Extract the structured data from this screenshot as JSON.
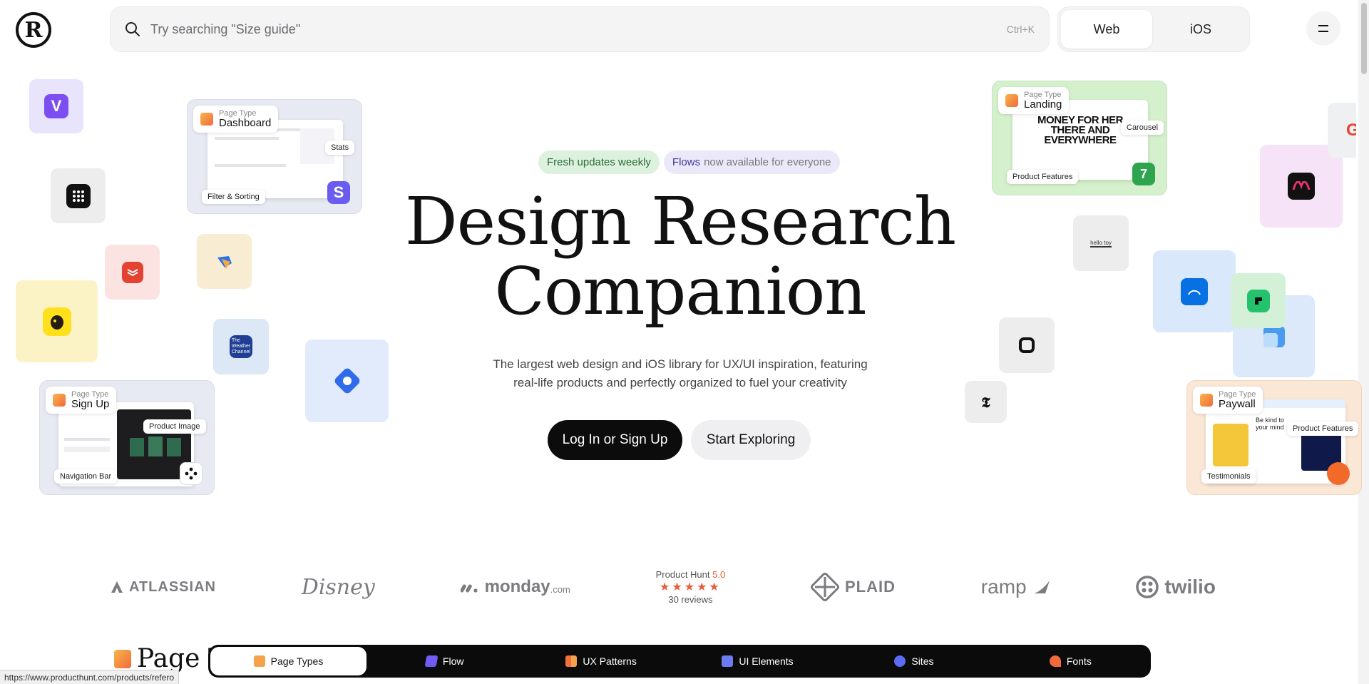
{
  "header": {
    "logo_text": "R",
    "search_placeholder": "Try searching \"Size guide\"",
    "search_shortcut": "Ctrl+K",
    "platform_options": [
      "Web",
      "iOS"
    ],
    "platform_selected": "Web"
  },
  "hero": {
    "badge_fresh": "Fresh updates weekly",
    "badge_flows_strong": "Flows",
    "badge_flows_rest": "now available for everyone",
    "title_line1": "Design Research",
    "title_line2": "Companion",
    "subtitle_line1": "The largest web design and iOS library for UX/UI inspiration, featuring",
    "subtitle_line2": "real-life products and perfectly organized to fuel your creativity",
    "cta_primary": "Log In or Sign Up",
    "cta_secondary": "Start Exploring"
  },
  "cards": {
    "dashboard": {
      "label": "Page Type",
      "value": "Dashboard",
      "chips": [
        "Stats",
        "Filter & Sorting"
      ]
    },
    "signup": {
      "label": "Page Type",
      "value": "Sign Up",
      "chips": [
        "Product Image",
        "Navigation Bar"
      ]
    },
    "landing": {
      "label": "Page Type",
      "value": "Landing",
      "chips": [
        "Carousel",
        "Product Features"
      ],
      "headline": "MONEY FOR HER THERE AND EVERYWHERE"
    },
    "paywall": {
      "label": "Page Type",
      "value": "Paywall",
      "chips": [
        "Product Features",
        "Testimonials"
      ],
      "snippet": "Be kind to your mind"
    }
  },
  "app_tiles": {
    "weather_channel": "The Weather Channel",
    "hello_text": "hello toy"
  },
  "logos": {
    "atlassian": "ATLASSIAN",
    "disney": "Disney",
    "monday": "monday",
    "monday_suffix": ".com",
    "product_hunt_label": "Product Hunt",
    "product_hunt_score": "5.0",
    "product_hunt_stars": "★★★★★",
    "product_hunt_reviews": "30 reviews",
    "plaid": "PLAID",
    "ramp": "ramp",
    "twilio": "twilio"
  },
  "section": {
    "heading_partial": "Page T"
  },
  "bottom_nav": {
    "items": [
      {
        "label": "Page Types",
        "color": "#f5a34a"
      },
      {
        "label": "Flow",
        "color": "#6f5cf5"
      },
      {
        "label": "UX Patterns",
        "color": "#f0713d"
      },
      {
        "label": "UI Elements",
        "color": "#6a7cf0"
      },
      {
        "label": "Sites",
        "color": "#5a6df2"
      },
      {
        "label": "Fonts",
        "color": "#f06a3b"
      }
    ],
    "active": "Page Types"
  },
  "status_url": "https://www.producthunt.com/products/refero",
  "colors": {
    "accent": "#0c0c0c",
    "green_badge": "#dcf1de",
    "purple_badge": "#ebe8fa"
  }
}
